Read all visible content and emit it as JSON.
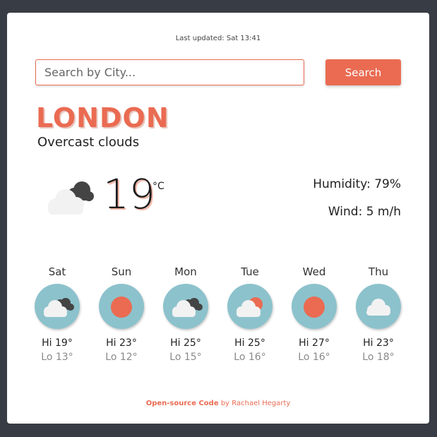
{
  "updated": "Last updated: Sat 13:41",
  "search": {
    "placeholder": "Search by City...",
    "button_label": "Search"
  },
  "current": {
    "city": "LONDON",
    "description": "Overcast clouds",
    "icon": "overcast-clouds-icon",
    "temperature": "19",
    "unit": "°C",
    "humidity": "Humidity: 79%",
    "wind": "Wind: 5 m/h"
  },
  "forecast": [
    {
      "day": "Sat",
      "icon": "overcast-clouds-icon",
      "hi": "Hi 19°",
      "lo": "Lo 13°"
    },
    {
      "day": "Sun",
      "icon": "sun-icon",
      "hi": "Hi 23°",
      "lo": "Lo 12°"
    },
    {
      "day": "Mon",
      "icon": "overcast-clouds-icon",
      "hi": "Hi 25°",
      "lo": "Lo 15°"
    },
    {
      "day": "Tue",
      "icon": "partly-cloudy-icon",
      "hi": "Hi 25°",
      "lo": "Lo 16°"
    },
    {
      "day": "Wed",
      "icon": "sun-icon",
      "hi": "Hi 27°",
      "lo": "Lo 16°"
    },
    {
      "day": "Thu",
      "icon": "cloud-icon",
      "hi": "Hi 23°",
      "lo": "Lo 18°"
    }
  ],
  "footer": {
    "code_link": "Open-source Code",
    "by": "by",
    "author": "Rachael Hegarty"
  },
  "colors": {
    "accent": "#ea6b52",
    "sky": "#8cc2cc",
    "background": "#383c44"
  }
}
